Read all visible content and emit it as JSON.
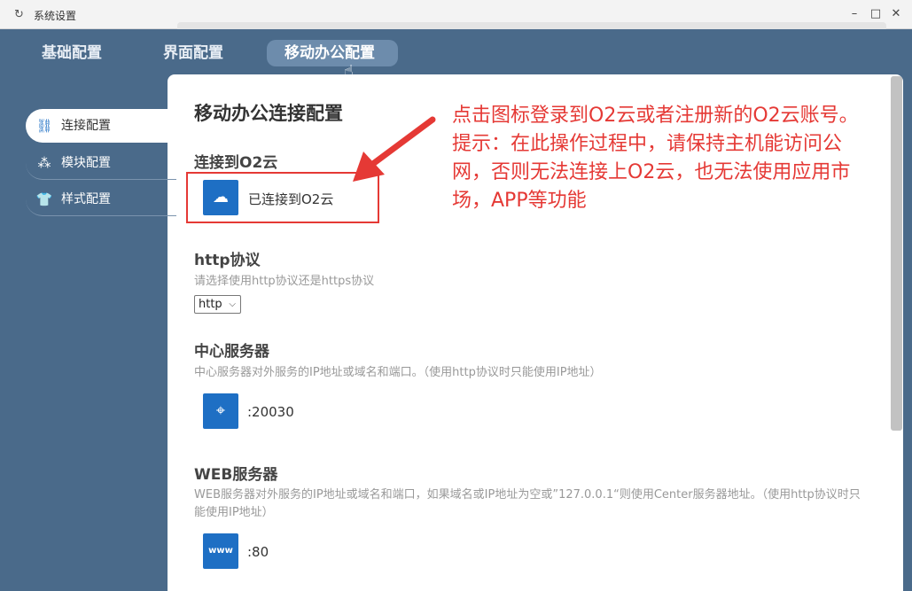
{
  "window": {
    "title": "系统设置"
  },
  "tabs": [
    {
      "label": "基础配置"
    },
    {
      "label": "界面配置"
    },
    {
      "label": "移动办公配置"
    }
  ],
  "sidebar": {
    "items": [
      {
        "label": "连接配置"
      },
      {
        "label": "模块配置"
      },
      {
        "label": "样式配置"
      }
    ]
  },
  "main": {
    "title": "移动办公连接配置",
    "cloud": {
      "heading": "连接到O2云",
      "status": "已连接到O2云"
    },
    "http": {
      "heading": "http协议",
      "desc": "请选择使用http协议还是https协议",
      "value": "http"
    },
    "center": {
      "heading": "中心服务器",
      "desc": "中心服务器对外服务的IP地址或域名和端口。（使用http协议时只能使用IP地址）",
      "value": ":20030"
    },
    "web": {
      "heading": "WEB服务器",
      "desc": "WEB服务器对外服务的IP地址或域名和端口，如果域名或IP地址为空或”127.0.0.1“则使用Center服务器地址。（使用http协议时只能使用IP地址）",
      "value": ":80"
    }
  },
  "annotation": {
    "line1": "点击图标登录到O2云或者注册新的O2云账号。",
    "line2": "提示：在此操作过程中，请保持主机能访问公网，否则无法连接上O2云，也无法使用应用市场，APP等功能"
  },
  "colors": {
    "accent": "#1e6fc4",
    "annotation": "#e53935",
    "chrome": "#4a6a8a"
  }
}
